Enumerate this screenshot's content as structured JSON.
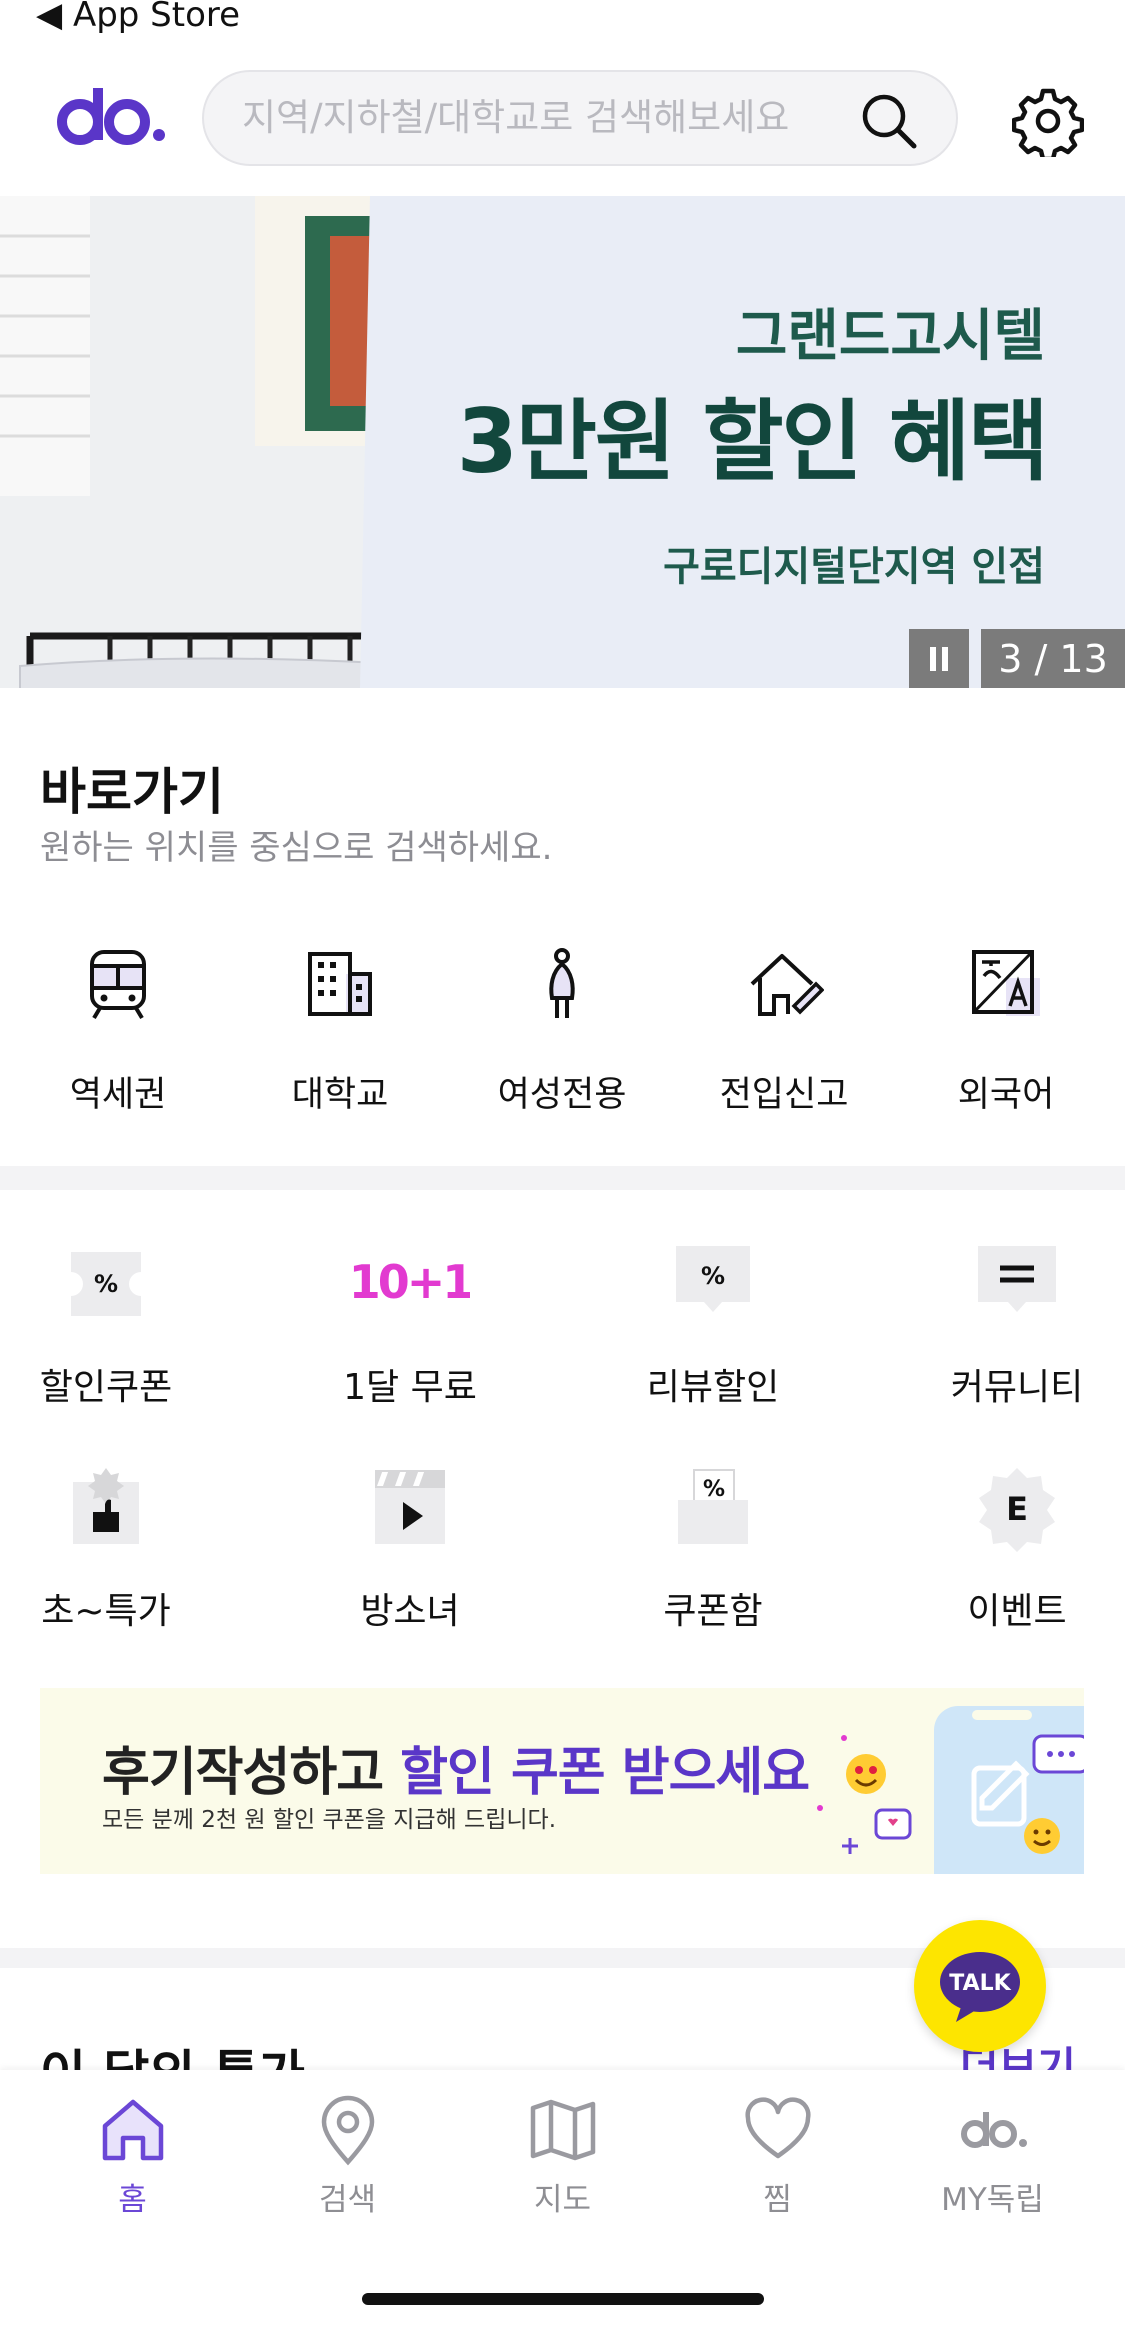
{
  "status_bar": {
    "back_label": "◀ App Store"
  },
  "header": {
    "logo_text": "do.",
    "search_placeholder": "지역/지하철/대학교로 검색해보세요"
  },
  "banner": {
    "title": "그랜드고시텔",
    "headline": "3만원 할인 혜택",
    "subtitle": "구로디지털단지역 인접",
    "counter": "3 / 13"
  },
  "shortcuts": {
    "title": "바로가기",
    "description": "원하는 위치를 중심으로 검색하세요.",
    "items": [
      {
        "label": "역세권",
        "icon": "train-icon"
      },
      {
        "label": "대학교",
        "icon": "building-icon"
      },
      {
        "label": "여성전용",
        "icon": "woman-icon"
      },
      {
        "label": "전입신고",
        "icon": "house-pen-icon"
      },
      {
        "label": "외국어",
        "icon": "language-icon"
      }
    ]
  },
  "menu": {
    "items": [
      {
        "label": "할인쿠폰",
        "icon": "coupon-icon"
      },
      {
        "label": "1달 무료",
        "icon": "ten-plus-one-icon",
        "icon_text": "10+1"
      },
      {
        "label": "리뷰할인",
        "icon": "review-discount-icon"
      },
      {
        "label": "커뮤니티",
        "icon": "community-icon"
      },
      {
        "label": "초~특가",
        "icon": "special-deal-icon"
      },
      {
        "label": "방소녀",
        "icon": "video-icon"
      },
      {
        "label": "쿠폰함",
        "icon": "coupon-box-icon"
      },
      {
        "label": "이벤트",
        "icon": "event-icon"
      }
    ]
  },
  "promo": {
    "headline_part1": "후기작성하고 ",
    "headline_part2": "할인 쿠폰 받으세요",
    "subtitle": "모든 분께 2천 원 할인 쿠폰을 지급해 드립니다."
  },
  "monthly": {
    "title": "이 달의 특가",
    "more_label": "더보기"
  },
  "talk": {
    "label": "TALK"
  },
  "tabbar": {
    "items": [
      {
        "label": "홈",
        "icon": "home-icon",
        "active": true
      },
      {
        "label": "검색",
        "icon": "location-pin-icon"
      },
      {
        "label": "지도",
        "icon": "map-icon"
      },
      {
        "label": "찜",
        "icon": "heart-icon"
      },
      {
        "label": "MY독립",
        "icon": "my-logo-icon"
      }
    ]
  },
  "colors": {
    "brand": "#5a36c8",
    "banner_text": "#12473d",
    "talk_bg": "#fde500"
  }
}
